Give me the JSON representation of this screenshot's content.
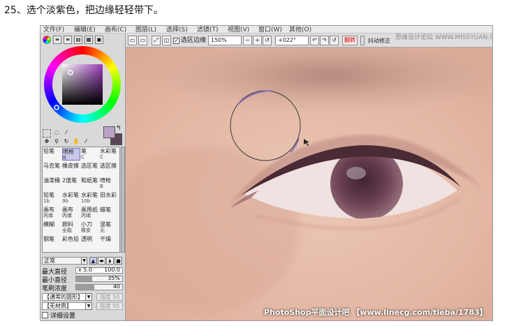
{
  "caption": "25、选个淡紫色，把边缘轻轻带下。",
  "menu": [
    "文件(F)",
    "编辑(E)",
    "画布(C)",
    "图层(L)",
    "选择(S)",
    "滤镜(T)",
    "视图(V)",
    "窗口(W)",
    "其他(O)"
  ],
  "toolbar": {
    "selection_edge_label": "选区边缘",
    "zoom_value": "150%",
    "angle_value": "+022°",
    "flip_label": "翻转",
    "stabilizer_label": "抖动修正",
    "watermark_site": "思缘设计论坛 WWW.MISSYUAN.COM"
  },
  "color": {
    "selected_hue": "#9a3db8",
    "foreground": "#b8a3c6",
    "background": "#5a4556"
  },
  "brushes": [
    {
      "name": "铅笔",
      "size": ""
    },
    {
      "name": "喷枪",
      "size": "B"
    },
    {
      "name": "笔",
      "size": "C"
    },
    {
      "name": "水彩笔",
      "size": "C"
    },
    {
      "name": "马克笔",
      "size": ""
    },
    {
      "name": "橡皮擦",
      "size": ""
    },
    {
      "name": "选区笔",
      "size": ""
    },
    {
      "name": "选区擦",
      "size": ""
    },
    {
      "name": "油漆桶",
      "size": ""
    },
    {
      "name": "2值笔",
      "size": ""
    },
    {
      "name": "和纸笔",
      "size": ""
    },
    {
      "name": "喷枪",
      "size": "B"
    },
    {
      "name": "铅笔",
      "size": "1b"
    },
    {
      "name": "水彩笔",
      "size": "9b"
    },
    {
      "name": "水彩笔",
      "size": "10b"
    },
    {
      "name": "旧水彩",
      "size": ""
    },
    {
      "name": "画布",
      "size": "丙烯"
    },
    {
      "name": "画布",
      "size": "丙烯"
    },
    {
      "name": "画用纸",
      "size": "丙烯"
    },
    {
      "name": "蜡笔",
      "size": ""
    },
    {
      "name": "模糊",
      "size": ""
    },
    {
      "name": "颜料",
      "size": "全能"
    },
    {
      "name": "小刀",
      "size": "橡皮"
    },
    {
      "name": "混笔",
      "size": "无"
    },
    {
      "name": "钢笔",
      "size": ""
    },
    {
      "name": "彩色铅",
      "size": ""
    },
    {
      "name": "透明",
      "size": ""
    },
    {
      "name": "干燥",
      "size": ""
    }
  ],
  "brush_props": {
    "blend_mode": "正常",
    "max_size_label": "最大直径",
    "size_multiplier": "x 5.0",
    "size_value": "100.0",
    "min_size_label": "最小直径",
    "min_size_value": "35%",
    "min_size_fraction": 0.35,
    "density_label": "笔刷浓度",
    "density_value": "40",
    "density_fraction": 0.4,
    "shape_select": "【通常的圆形】",
    "texture_select": "【无材质】",
    "shape_strength_label": "强度",
    "shape_strength_value": "50",
    "texture_strength_label": "强度",
    "texture_strength_value": "95",
    "detail_label": "详细设置"
  },
  "bottom_watermark": "PhotoShop平面设计吧 【www.linecg.com/tieba/1783】"
}
